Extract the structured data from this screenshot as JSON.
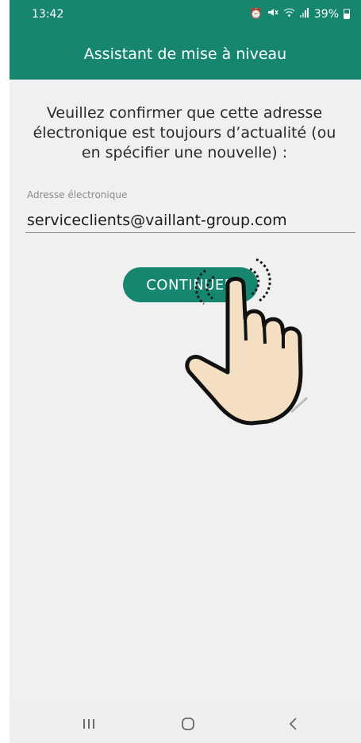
{
  "status_bar": {
    "time": "13:42",
    "icons": [
      "alarm-icon",
      "mute-icon",
      "wifi-icon",
      "signal-icon",
      "battery-icon"
    ],
    "battery_percent": "39%"
  },
  "app_bar": {
    "title": "Assistant de mise à niveau"
  },
  "main": {
    "message": "Veuillez confirmer que cette adresse électronique est toujours d’actualité (ou en spécifier une nouvelle) :",
    "email_label": "Adresse électronique",
    "email_value": "serviceclients@vaillant-group.com",
    "continue_label": "CONTINUER"
  },
  "nav_bar": {
    "buttons": [
      "recents-icon",
      "home-icon",
      "back-icon"
    ]
  },
  "colors": {
    "primary": "#16876e",
    "background": "#f0f0f0",
    "text": "#2a2a2a"
  }
}
